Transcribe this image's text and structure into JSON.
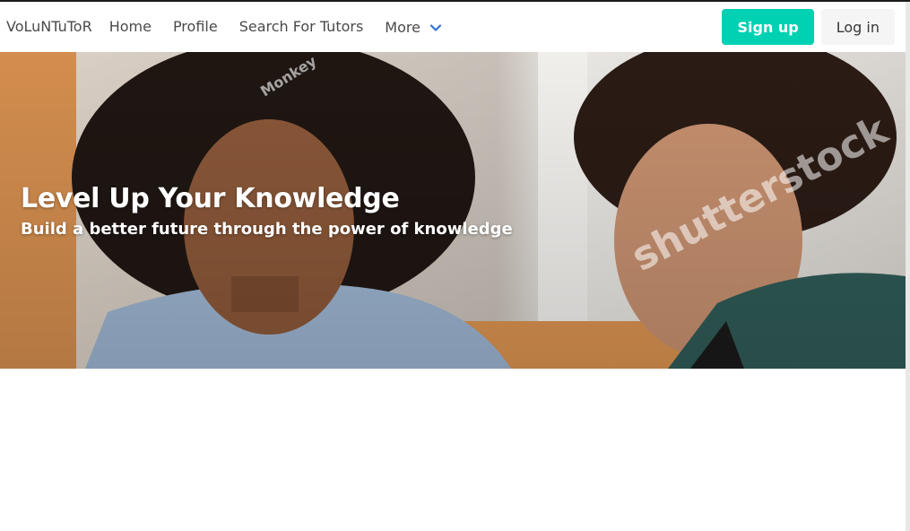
{
  "navbar": {
    "brand": "VoLuNTuToR",
    "items": [
      {
        "label": "Home"
      },
      {
        "label": "Profile"
      },
      {
        "label": "Search For Tutors"
      }
    ],
    "more_label": "More",
    "signup_label": "Sign up",
    "login_label": "Log in"
  },
  "hero": {
    "title": "Level Up Your Knowledge",
    "subtitle": "Build a better future through the power of knowledge",
    "watermark": "shutterstock",
    "watermark_small": "Monkey"
  },
  "colors": {
    "primary": "#00d1b2",
    "chevron": "#3273dc"
  }
}
